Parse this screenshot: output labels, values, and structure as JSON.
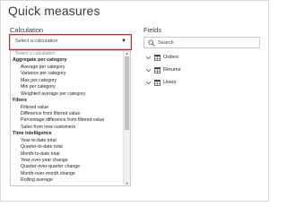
{
  "dialog": {
    "title": "Quick measures"
  },
  "calculation": {
    "label": "Calculation",
    "select_value": "Select a calculation",
    "dropdown_items": [
      {
        "type": "placeholder",
        "label": "Select a calculation"
      },
      {
        "type": "header",
        "label": "Aggregate per category"
      },
      {
        "type": "option",
        "label": "Average per category"
      },
      {
        "type": "option",
        "label": "Variance per category"
      },
      {
        "type": "option",
        "label": "Max per category"
      },
      {
        "type": "option",
        "label": "Min per category"
      },
      {
        "type": "option",
        "label": "Weighted average per category"
      },
      {
        "type": "header",
        "label": "Filters"
      },
      {
        "type": "option",
        "label": "Filtered value"
      },
      {
        "type": "option",
        "label": "Difference from filtered value"
      },
      {
        "type": "option",
        "label": "Percentage difference from filtered value"
      },
      {
        "type": "option",
        "label": "Sales from new customers"
      },
      {
        "type": "header",
        "label": "Time intelligence"
      },
      {
        "type": "option",
        "label": "Year-to-date total"
      },
      {
        "type": "option",
        "label": "Quarter-to-date total"
      },
      {
        "type": "option",
        "label": "Month-to-date total"
      },
      {
        "type": "option",
        "label": "Year-over-year change"
      },
      {
        "type": "option",
        "label": "Quarter-over-quarter change"
      },
      {
        "type": "option",
        "label": "Month-over-month change"
      },
      {
        "type": "option",
        "label": "Rolling average"
      }
    ]
  },
  "fields": {
    "label": "Fields",
    "search_placeholder": "Search",
    "tables": [
      {
        "name": "Orders"
      },
      {
        "name": "Returns"
      },
      {
        "name": "Users"
      }
    ]
  },
  "colors": {
    "highlight_border": "#c4262e",
    "text": "#252423"
  },
  "icons": {
    "close": "close-icon",
    "dropdown": "chevron-down-icon",
    "search": "search-icon",
    "table": "table-icon",
    "expand": "chevron-down-icon"
  }
}
